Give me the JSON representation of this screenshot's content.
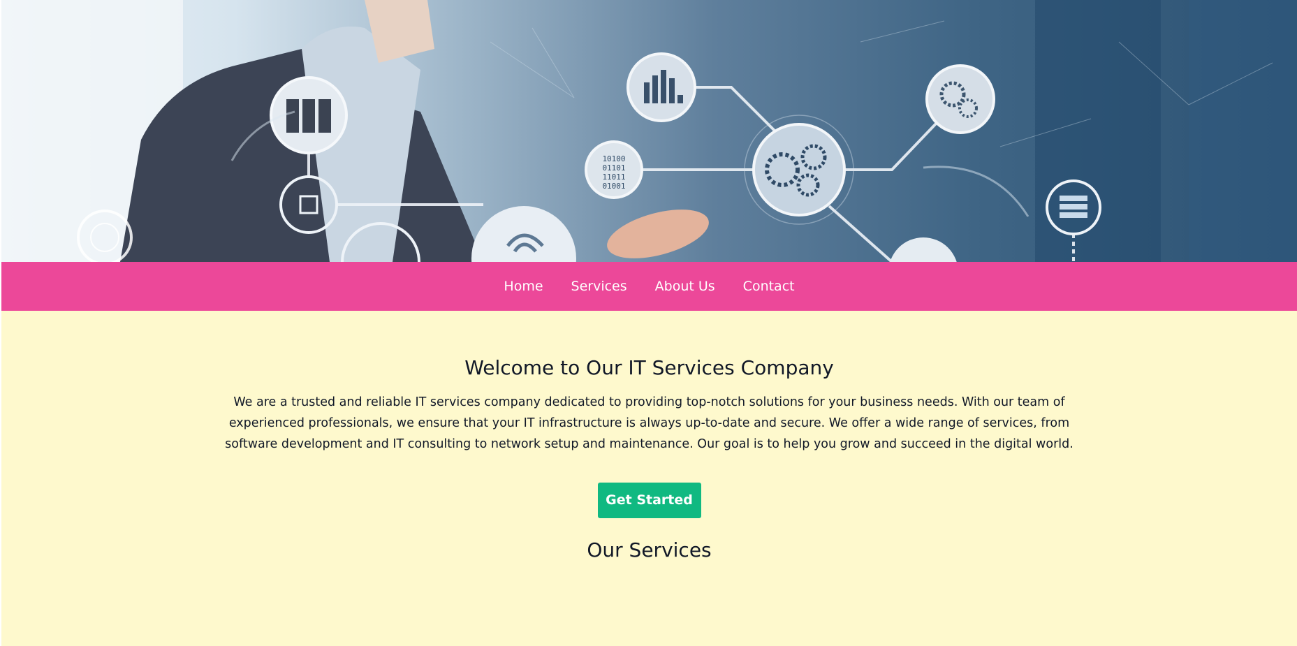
{
  "hero": {
    "image_icon": "it-network-banner",
    "binary_lines": [
      "10100",
      "01101",
      "11011",
      "01001"
    ]
  },
  "nav": {
    "items": [
      {
        "label": "Home"
      },
      {
        "label": "Services"
      },
      {
        "label": "About Us"
      },
      {
        "label": "Contact"
      }
    ],
    "background": "#ec4899"
  },
  "main": {
    "title": "Welcome to Our IT Services Company",
    "description": "We are a trusted and reliable IT services company dedicated to providing top-notch solutions for your business needs. With our team of experienced professionals, we ensure that your IT infrastructure is always up-to-date and secure. We offer a wide range of services, from software development and IT consulting to network setup and maintenance. Our goal is to help you grow and succeed in the digital world.",
    "cta_label": "Get Started",
    "services_heading": "Our Services",
    "cta_color": "#10b981",
    "background": "#fef9cd"
  }
}
